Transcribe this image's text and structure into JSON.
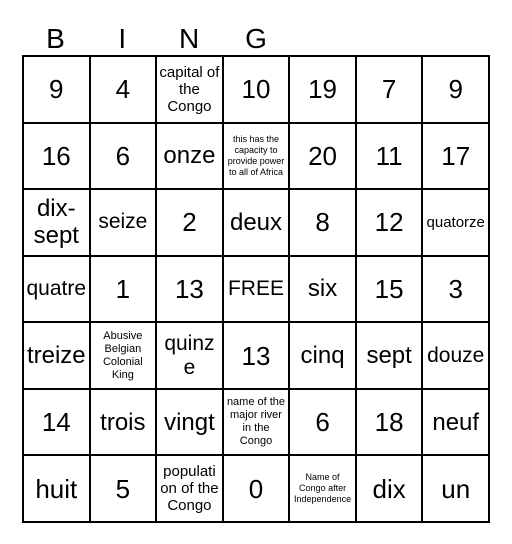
{
  "card": {
    "title_letters": [
      "B",
      "I",
      "N",
      "G",
      "",
      "",
      ""
    ],
    "free_label": "FREE",
    "colors": {
      "border": "#000000",
      "background": "#ffffff",
      "text": "#000000"
    },
    "grid": {
      "columns": 7,
      "rows": 7,
      "cells": [
        [
          {
            "text": "9",
            "size": "xl"
          },
          {
            "text": "4",
            "size": "xl"
          },
          {
            "text": "capital of the Congo",
            "size": "sm"
          },
          {
            "text": "10",
            "size": "xl"
          },
          {
            "text": "19",
            "size": "xl"
          },
          {
            "text": "7",
            "size": "xl"
          },
          {
            "text": "9",
            "size": "xl"
          }
        ],
        [
          {
            "text": "16",
            "size": "xl"
          },
          {
            "text": "6",
            "size": "xl"
          },
          {
            "text": "onze",
            "size": "lg"
          },
          {
            "text": "this has the capacity to provide power to all of Africa",
            "size": "xxs"
          },
          {
            "text": "20",
            "size": "xl"
          },
          {
            "text": "11",
            "size": "xl"
          },
          {
            "text": "17",
            "size": "xl"
          }
        ],
        [
          {
            "text": "dix-sept",
            "size": "lg"
          },
          {
            "text": "seize",
            "size": "md"
          },
          {
            "text": "2",
            "size": "xl"
          },
          {
            "text": "deux",
            "size": "lg"
          },
          {
            "text": "8",
            "size": "xl"
          },
          {
            "text": "12",
            "size": "xl"
          },
          {
            "text": "quatorze",
            "size": "sm"
          }
        ],
        [
          {
            "text": "quatre",
            "size": "md"
          },
          {
            "text": "1",
            "size": "xl"
          },
          {
            "text": "13",
            "size": "xl"
          },
          {
            "text": "FREE",
            "size": "md"
          },
          {
            "text": "six",
            "size": "lg"
          },
          {
            "text": "15",
            "size": "xl"
          },
          {
            "text": "3",
            "size": "xl"
          }
        ],
        [
          {
            "text": "treize",
            "size": "lg"
          },
          {
            "text": "Abusive Belgian Colonial King",
            "size": "xs"
          },
          {
            "text": "quinze",
            "size": "md"
          },
          {
            "text": "13",
            "size": "xl"
          },
          {
            "text": "cinq",
            "size": "lg"
          },
          {
            "text": "sept",
            "size": "lg"
          },
          {
            "text": "douze",
            "size": "md"
          }
        ],
        [
          {
            "text": "14",
            "size": "xl"
          },
          {
            "text": "trois",
            "size": "lg"
          },
          {
            "text": "vingt",
            "size": "lg"
          },
          {
            "text": "name of the major river in the Congo",
            "size": "xs"
          },
          {
            "text": "6",
            "size": "xl"
          },
          {
            "text": "18",
            "size": "xl"
          },
          {
            "text": "neuf",
            "size": "lg"
          }
        ],
        [
          {
            "text": "huit",
            "size": "xl"
          },
          {
            "text": "5",
            "size": "xl"
          },
          {
            "text": "population of the Congo",
            "size": "sm"
          },
          {
            "text": "0",
            "size": "xl"
          },
          {
            "text": "Name of Congo after Independence",
            "size": "xxs"
          },
          {
            "text": "dix",
            "size": "xl"
          },
          {
            "text": "un",
            "size": "xl"
          }
        ]
      ]
    }
  }
}
